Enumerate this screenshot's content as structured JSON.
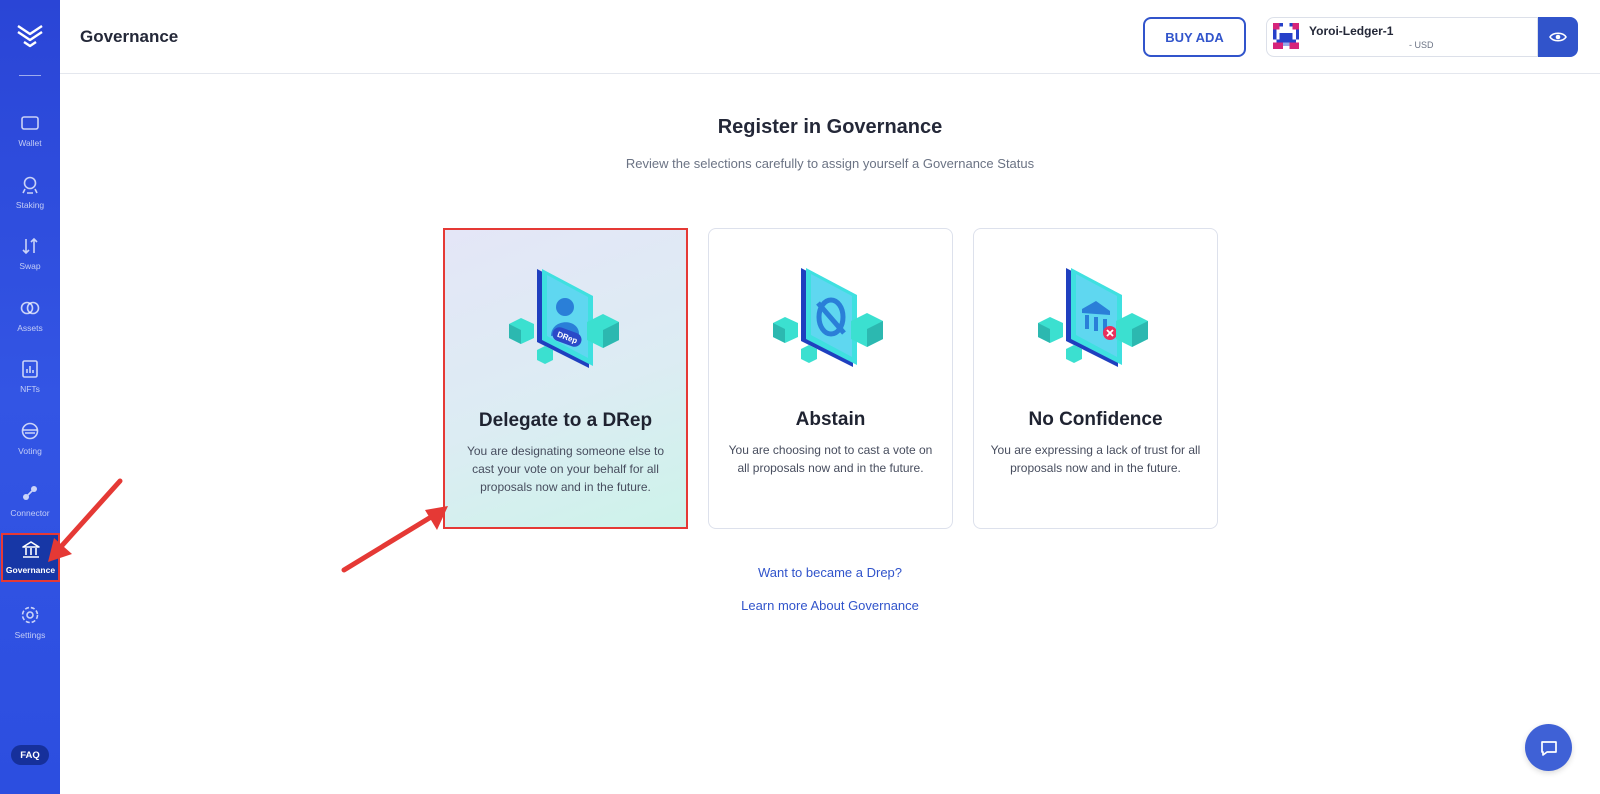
{
  "sidebar": {
    "items": [
      {
        "label": "Wallet",
        "icon": "wallet-icon"
      },
      {
        "label": "Staking",
        "icon": "staking-icon"
      },
      {
        "label": "Swap",
        "icon": "swap-icon"
      },
      {
        "label": "Assets",
        "icon": "assets-icon"
      },
      {
        "label": "NFTs",
        "icon": "nfts-icon"
      },
      {
        "label": "Voting",
        "icon": "voting-icon"
      },
      {
        "label": "Connector",
        "icon": "connector-icon"
      },
      {
        "label": "Governance",
        "icon": "governance-icon",
        "active": true
      },
      {
        "label": "Settings",
        "icon": "settings-icon"
      }
    ],
    "faq_label": "FAQ"
  },
  "header": {
    "title": "Governance",
    "buy_label": "BUY ADA",
    "wallet": {
      "name": "Yoroi-Ledger-1",
      "balance": "- USD"
    }
  },
  "main": {
    "title": "Register in Governance",
    "subtitle": "Review the selections carefully to assign yourself a Governance Status",
    "cards": [
      {
        "title": "Delegate to a DRep",
        "description": "You are designating someone else to cast your vote on your behalf for all proposals now and in the future.",
        "badge": "DRep",
        "selected": true
      },
      {
        "title": "Abstain",
        "description": "You are choosing not to cast a vote on all proposals now and in the future."
      },
      {
        "title": "No Confidence",
        "description": "You are expressing a lack of trust for all proposals now and in the future."
      }
    ],
    "links": {
      "become_drep": "Want to became a Drep?",
      "learn_more": "Learn more About Governance"
    }
  },
  "colors": {
    "sidebar": "#2d4fe0",
    "accent": "#3154cb",
    "annotation": "#e53935"
  }
}
